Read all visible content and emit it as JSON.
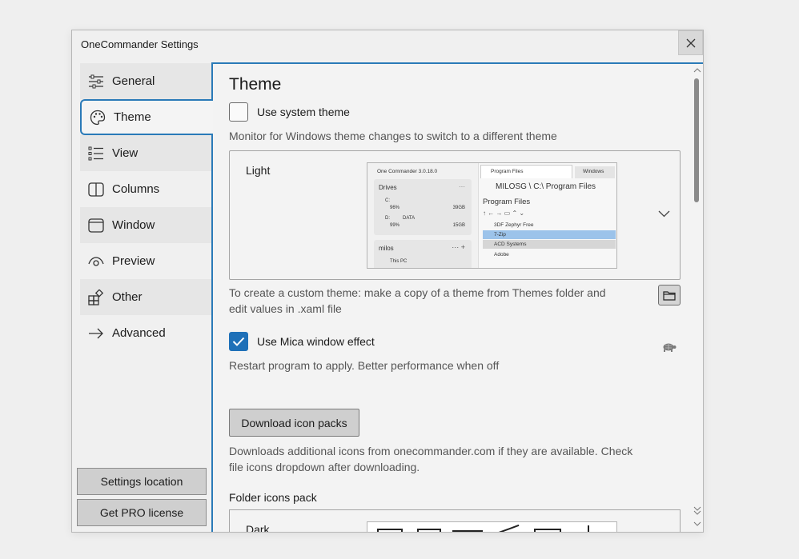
{
  "window": {
    "title": "OneCommander Settings"
  },
  "sidebar": {
    "items": [
      {
        "label": "General",
        "icon": "sliders-icon"
      },
      {
        "label": "Theme",
        "icon": "palette-icon"
      },
      {
        "label": "View",
        "icon": "list-icon"
      },
      {
        "label": "Columns",
        "icon": "columns-icon"
      },
      {
        "label": "Window",
        "icon": "window-icon"
      },
      {
        "label": "Preview",
        "icon": "eye-icon"
      },
      {
        "label": "Other",
        "icon": "apps-icon"
      },
      {
        "label": "Advanced",
        "icon": "arrow-right-icon"
      }
    ],
    "active": "Theme",
    "settings_location": "Settings location",
    "get_pro": "Get PRO license"
  },
  "theme": {
    "heading": "Theme",
    "use_system_theme": {
      "label": "Use system theme",
      "checked": false
    },
    "system_hint": "Monitor for Windows theme changes to switch to a different theme",
    "selected_theme": "Light",
    "custom_hint_line1": "To create a custom theme: make a copy of a theme from Themes folder and",
    "custom_hint_line2": "edit values in .xaml file",
    "use_mica": {
      "label": "Use Mica window effect",
      "checked": true
    },
    "mica_hint": "Restart program to apply. Better performance when off",
    "download_button": "Download icon packs",
    "download_hint_line1": "Downloads additional icons from onecommander.com if they are available. Check",
    "download_hint_line2": "file icons dropdown after downloading.",
    "folder_icons_label": "Folder icons pack",
    "folder_icons_selected": "Dark"
  },
  "preview": {
    "app_title": "One Commander 3.0.18.0",
    "tab1": "Program Files",
    "tab2": "Windows",
    "drives_label": "Drives",
    "drive_c": "C:",
    "drive_c_pct": "96%",
    "drive_c_size": "39GB",
    "drive_d": "D:",
    "drive_d_name": "DATA",
    "drive_d_pct": "99%",
    "drive_d_size": "15GB",
    "path": "MILOSG \\ C:\\ Program Files",
    "folder_title": "Program Files",
    "files": [
      "3DF Zephyr Free",
      "7-Zip",
      "ACD Systems",
      "Adobe"
    ],
    "user": "milos",
    "this_pc": "This PC"
  },
  "colors": {
    "accent": "#2a7ab8",
    "checkbox": "#1e70b8",
    "selection": "#9cc3ea"
  }
}
